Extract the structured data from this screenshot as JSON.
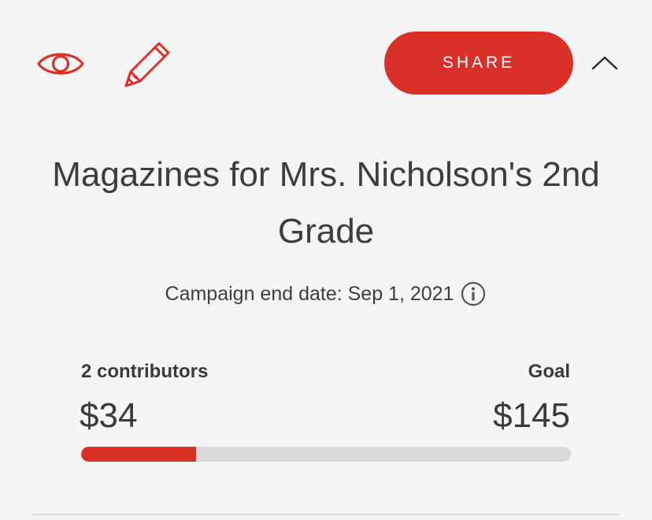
{
  "header": {
    "view_icon": "eye-icon",
    "edit_icon": "pencil-icon",
    "share_label": "SHARE",
    "collapse_icon": "chevron-up-icon"
  },
  "campaign": {
    "title": "Magazines for Mrs. Nicholson's 2nd Grade",
    "end_date_text": "Campaign end date: Sep 1, 2021",
    "info_icon": "info-icon"
  },
  "funding": {
    "contributors_label": "2 contributors",
    "raised": "$34",
    "goal_label": "Goal",
    "goal": "$145",
    "progress_fraction": 0.2345
  },
  "colors": {
    "accent": "#d93127",
    "track": "#d9d9d9",
    "background": "#f5f5f5",
    "text": "#3a3a3a"
  }
}
